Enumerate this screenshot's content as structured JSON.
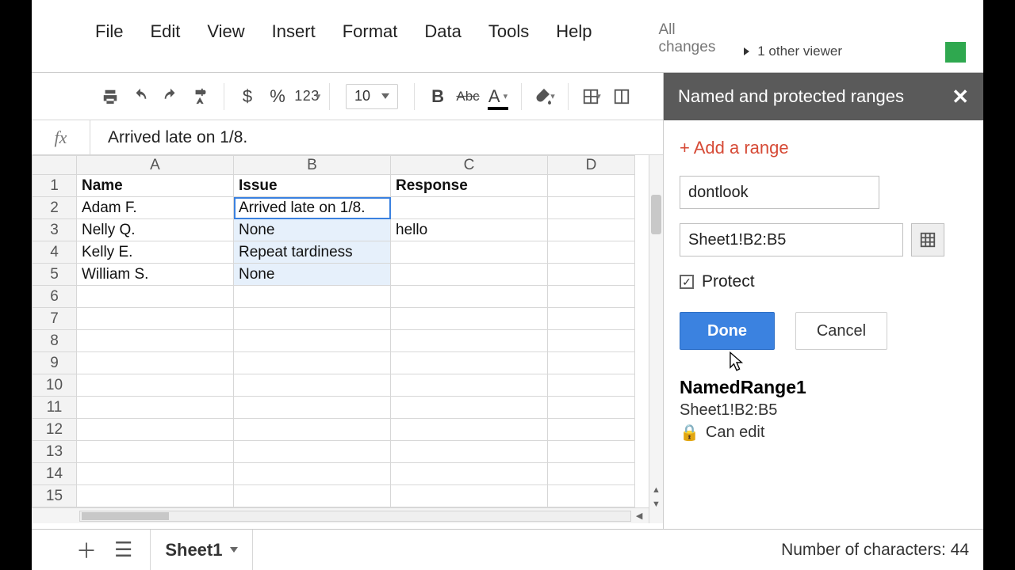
{
  "menu": {
    "file": "File",
    "edit": "Edit",
    "view": "View",
    "insert": "Insert",
    "format": "Format",
    "data": "Data",
    "tools": "Tools",
    "help": "Help"
  },
  "save_status": "All changes",
  "viewer": {
    "text": "1 other viewer"
  },
  "toolbar": {
    "dollar": "$",
    "percent": "%",
    "num123": "123",
    "font_size": "10",
    "bold": "B",
    "strike": "Abc",
    "textA": "A"
  },
  "fx": {
    "label": "fx",
    "value": "Arrived late on 1/8."
  },
  "columns": [
    "A",
    "B",
    "C",
    "D"
  ],
  "headers": {
    "A": "Name",
    "B": "Issue",
    "C": "Response"
  },
  "rows": [
    {
      "n": 1
    },
    {
      "n": 2,
      "A": "Adam F.",
      "B": "Arrived late on 1/8.",
      "C": ""
    },
    {
      "n": 3,
      "A": "Nelly Q.",
      "B": "None",
      "C": "hello"
    },
    {
      "n": 4,
      "A": "Kelly E.",
      "B": "Repeat tardiness",
      "C": ""
    },
    {
      "n": 5,
      "A": "William S.",
      "B": "None",
      "C": ""
    },
    {
      "n": 6
    },
    {
      "n": 7
    },
    {
      "n": 8
    },
    {
      "n": 9
    },
    {
      "n": 10
    },
    {
      "n": 11
    },
    {
      "n": 12
    },
    {
      "n": 13
    },
    {
      "n": 14
    },
    {
      "n": 15
    }
  ],
  "panel": {
    "title": "Named and protected ranges",
    "add": "+ Add a range",
    "name_value": "dontlook",
    "range_value": "Sheet1!B2:B5",
    "protect": "Protect",
    "done": "Done",
    "cancel": "Cancel",
    "existing_name": "NamedRange1",
    "existing_range": "Sheet1!B2:B5",
    "existing_perm": "Can edit"
  },
  "bottom": {
    "sheet": "Sheet1",
    "chars": "Number of characters: 44"
  }
}
